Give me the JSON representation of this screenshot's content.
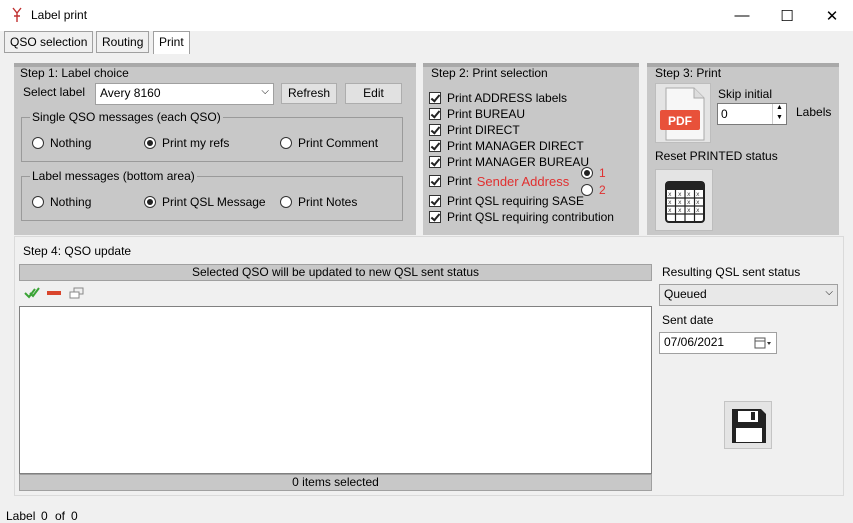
{
  "window": {
    "title": "Label print",
    "minimize": "—",
    "maximize": "☐",
    "close": "✕"
  },
  "tabs": [
    "QSO selection",
    "Routing",
    "Print"
  ],
  "step1": {
    "title": "Step 1: Label choice",
    "select_label": "Select label",
    "label_value": "Avery 8160",
    "refresh": "Refresh",
    "edit": "Edit",
    "single": {
      "title": "Single QSO messages (each QSO)",
      "options": [
        "Nothing",
        "Print my refs",
        "Print Comment"
      ],
      "selected": 1
    },
    "label_messages": {
      "title": "Label messages (bottom area)",
      "options": [
        "Nothing",
        "Print QSL Message",
        "Print Notes"
      ],
      "selected": 1
    }
  },
  "step2": {
    "title": "Step 2: Print selection",
    "items": [
      "Print ADDRESS labels",
      "Print BUREAU",
      "Print DIRECT",
      "Print MANAGER DIRECT",
      "Print MANAGER BUREAU"
    ],
    "sender_print": "Print",
    "sender_label": "Sender Address",
    "sender_opt1": "1",
    "sender_opt2": "2",
    "items2": [
      "Print QSL requiring SASE",
      "Print QSL requiring contribution"
    ]
  },
  "step3": {
    "title": "Step 3: Print",
    "pdf": "PDF",
    "skip_initial": "Skip initial",
    "skip_value": "0",
    "labels": "Labels",
    "reset": "Reset PRINTED status"
  },
  "step4": {
    "title": "Step 4: QSO update",
    "header": "Selected QSO will be updated to new QSL sent status",
    "footer": "0 items selected",
    "resulting_label": "Resulting QSL sent status",
    "status_value": "Queued",
    "sent_date_label": "Sent date",
    "sent_date_value": "07/06/2021"
  },
  "statusbar": {
    "label": "Label",
    "current": "0",
    "of": "of",
    "total": "0"
  }
}
